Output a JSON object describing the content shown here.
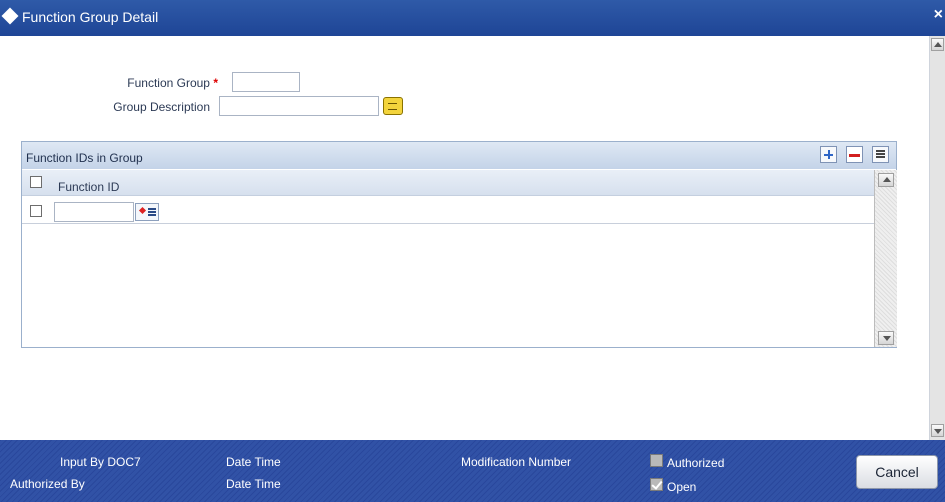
{
  "window": {
    "title": "Function Group Detail",
    "close_glyph": "×"
  },
  "form": {
    "function_group": {
      "label": "Function Group",
      "required_mark": "*",
      "value": ""
    },
    "group_description": {
      "label": "Group Description",
      "value": ""
    }
  },
  "grid": {
    "title": "Function IDs in Group",
    "columns": [
      "Function ID"
    ],
    "rows": [
      {
        "function_id": ""
      }
    ]
  },
  "footer": {
    "input_by": "Input By DOC7",
    "date_time_1": "Date Time",
    "modification_number": "Modification Number",
    "authorized": {
      "label": "Authorized",
      "checked": false
    },
    "authorized_by": "Authorized By",
    "date_time_2": "Date Time",
    "open": {
      "label": "Open",
      "checked": true
    },
    "cancel_label": "Cancel"
  },
  "icons": [
    "diamond-icon",
    "close-icon",
    "description-icon",
    "add-row-icon",
    "delete-row-icon",
    "single-view-icon",
    "list-of-values-icon"
  ]
}
